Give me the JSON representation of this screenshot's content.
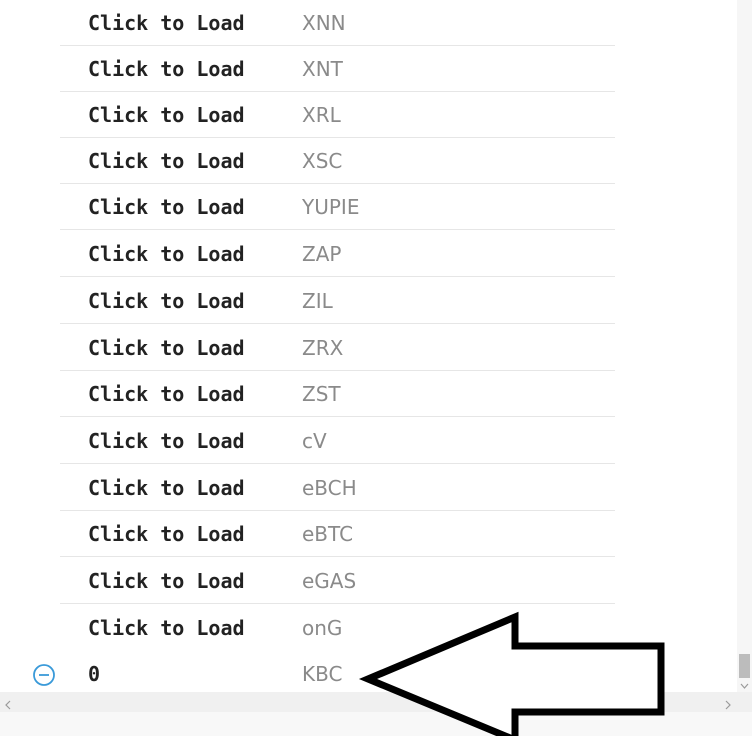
{
  "list": {
    "button_label": "Click to Load",
    "rows": [
      {
        "symbol": "XNN"
      },
      {
        "symbol": "XNT"
      },
      {
        "symbol": "XRL"
      },
      {
        "symbol": "XSC"
      },
      {
        "symbol": "YUPIE"
      },
      {
        "symbol": "ZAP"
      },
      {
        "symbol": "ZIL"
      },
      {
        "symbol": "ZRX"
      },
      {
        "symbol": "ZST"
      },
      {
        "symbol": "cV"
      },
      {
        "symbol": "eBCH"
      },
      {
        "symbol": "eBTC"
      },
      {
        "symbol": "eGAS"
      },
      {
        "symbol": "onG"
      }
    ],
    "bottom_row": {
      "value": "0",
      "symbol": "KBC",
      "icon": "minus-circle-icon"
    }
  },
  "colors": {
    "accent": "#3a9ad9",
    "text": "#222222",
    "muted": "#8a8a8a"
  },
  "annotation": {
    "icon": "arrow-left-icon"
  }
}
